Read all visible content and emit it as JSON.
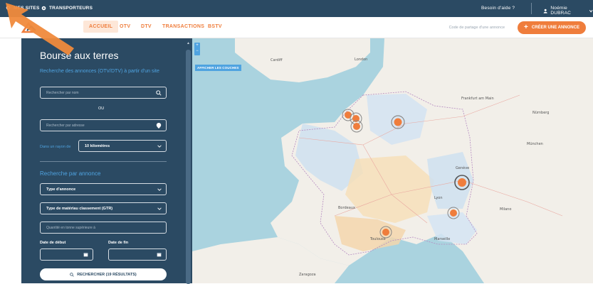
{
  "topbar": {
    "sites": "MES SITES",
    "transporteurs": "TRANSPORTEURS",
    "help": "Besoin d'aide ?",
    "user": "Noémie DUBRAC"
  },
  "nav": {
    "items": [
      "ACCUEIL",
      "OTV",
      "DTV",
      "TRANSACTIONS",
      "BSTV"
    ],
    "code_link": "Code de partage d'une annonce",
    "create": "CRÉER UNE ANNONCE"
  },
  "panel": {
    "title": "Bourse aux terres",
    "subtitle": "Recherche des annonces (OTV/DTV) à partir d'un site",
    "search_name_placeholder": "Rechercher par nom",
    "or": "OU",
    "search_address_placeholder": "Rechercher par adresse",
    "radius_label": "Dans un rayon de",
    "radius_value": "10 kilomètres",
    "section2": "Recherche par annonce",
    "type_annonce": "Type d'annonce",
    "type_materiau": "Type de matériau classement (GTR)",
    "quantite_placeholder": "Quantité en tonne supérieure à",
    "date_debut": "Date de début",
    "date_fin": "Date de fin",
    "search_button": "RECHERCHER (19 RÉSULTATS)"
  },
  "map": {
    "layers_button": "AFFICHER LES COUCHES",
    "labels": [
      {
        "t": "London"
      },
      {
        "t": "Bordeaux"
      },
      {
        "t": "Lyon"
      },
      {
        "t": "Marseille"
      },
      {
        "t": "Toulouse"
      },
      {
        "t": "Genève"
      },
      {
        "t": "Milano"
      },
      {
        "t": "Frankfurt am Main"
      },
      {
        "t": "München"
      },
      {
        "t": "Zaragoza"
      },
      {
        "t": "Cardiff"
      },
      {
        "t": "Nürnberg"
      }
    ]
  },
  "colors": {
    "navy": "#2b4a63",
    "orange": "#ef7d3c",
    "blue_accent": "#4fa3e0"
  }
}
